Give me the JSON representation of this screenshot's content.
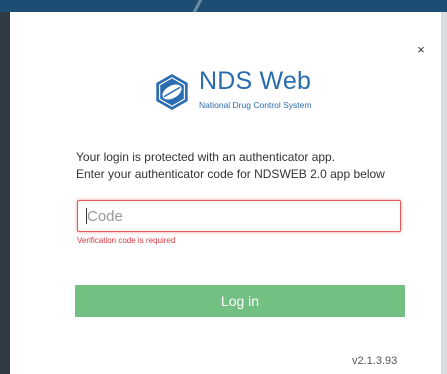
{
  "dialog": {
    "close_label": "×"
  },
  "logo": {
    "title": "NDS Web",
    "subtitle": "National Drug Control System",
    "icon": "nds-logo-icon",
    "brand_color": "#2b6cb0"
  },
  "intro": {
    "line1": "Your login is protected with an authenticator app.",
    "line2": "Enter your authenticator code for NDSWEB 2.0 app below"
  },
  "code_field": {
    "placeholder": "Code",
    "value": "",
    "error": "Verification code is required",
    "error_color": "#d9363e"
  },
  "login_button": {
    "label": "Log in",
    "color": "#72c082"
  },
  "version": "v2.1.3.93"
}
